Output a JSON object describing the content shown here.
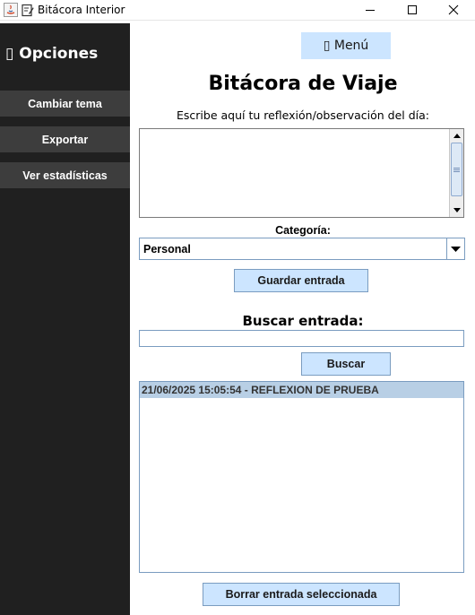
{
  "window": {
    "title": "Bitácora Interior",
    "controls": [
      "minimize-icon",
      "maximize-icon",
      "close-icon"
    ]
  },
  "sidebar": {
    "title_icon": "▯",
    "title": "Opciones",
    "items": [
      {
        "label": "Cambiar tema"
      },
      {
        "label": "Exportar"
      },
      {
        "label": "Ver estadísticas"
      }
    ],
    "background": "#202020",
    "button_color": "#3d3d3d"
  },
  "main": {
    "menu_icon": "▯",
    "menu_label": "Menú",
    "title": "Bitácora de Viaje",
    "prompt": "Escribe aquí tu reflexión/observación del día:",
    "reflection_text": "",
    "category": {
      "label": "Categoría:",
      "selected": "Personal"
    },
    "save_label": "Guardar entrada",
    "search": {
      "label": "Buscar entrada:",
      "value": "",
      "button_label": "Buscar"
    },
    "entries": [
      {
        "text": "21/06/2025 15:05:54 - REFLEXION DE PRUEBA",
        "selected": true
      }
    ],
    "delete_label": "Borrar entrada seleccionada",
    "accent": "#cce5ff"
  }
}
